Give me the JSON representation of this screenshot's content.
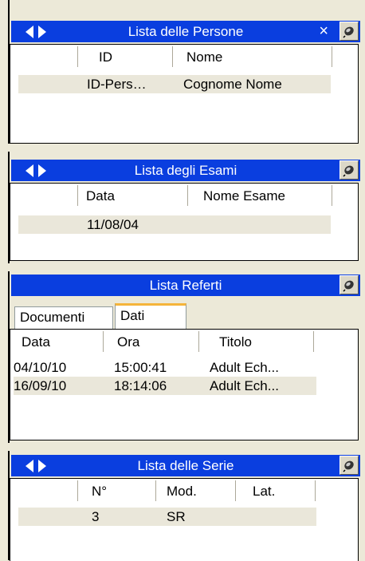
{
  "panels": {
    "persone": {
      "title": "Lista delle Persone",
      "close_glyph": "×",
      "columns": [
        "ID",
        "Nome"
      ],
      "rows": [
        [
          "ID-Pers…",
          "Cognome Nome"
        ]
      ]
    },
    "esami": {
      "title": "Lista degli Esami",
      "columns": [
        "Data",
        "Nome Esame"
      ],
      "rows": [
        [
          "11/08/04",
          ""
        ]
      ]
    },
    "referti": {
      "title": "Lista Referti",
      "tabs": [
        "Documenti",
        "Dati"
      ],
      "selected_tab": "Dati",
      "columns": [
        "Data",
        "Ora",
        "Titolo"
      ],
      "rows": [
        [
          "04/10/10",
          "15:00:41",
          "Adult Ech..."
        ],
        [
          "16/09/10",
          "18:14:06",
          "Adult Ech..."
        ]
      ]
    },
    "serie": {
      "title": "Lista delle Serie",
      "columns": [
        "N°",
        "Mod.",
        "Lat."
      ],
      "rows": [
        [
          "3",
          "SR",
          ""
        ]
      ]
    }
  },
  "icons": {
    "nav": [
      "arrow-left-icon",
      "arrow-right-icon"
    ],
    "pin": "pin-icon"
  },
  "colors": {
    "titlebar": "#0A3EDF",
    "row_shade": "#EAE7DA",
    "window_bg": "#ECE9D8",
    "selected_tab_accent": "#F5B43A"
  }
}
